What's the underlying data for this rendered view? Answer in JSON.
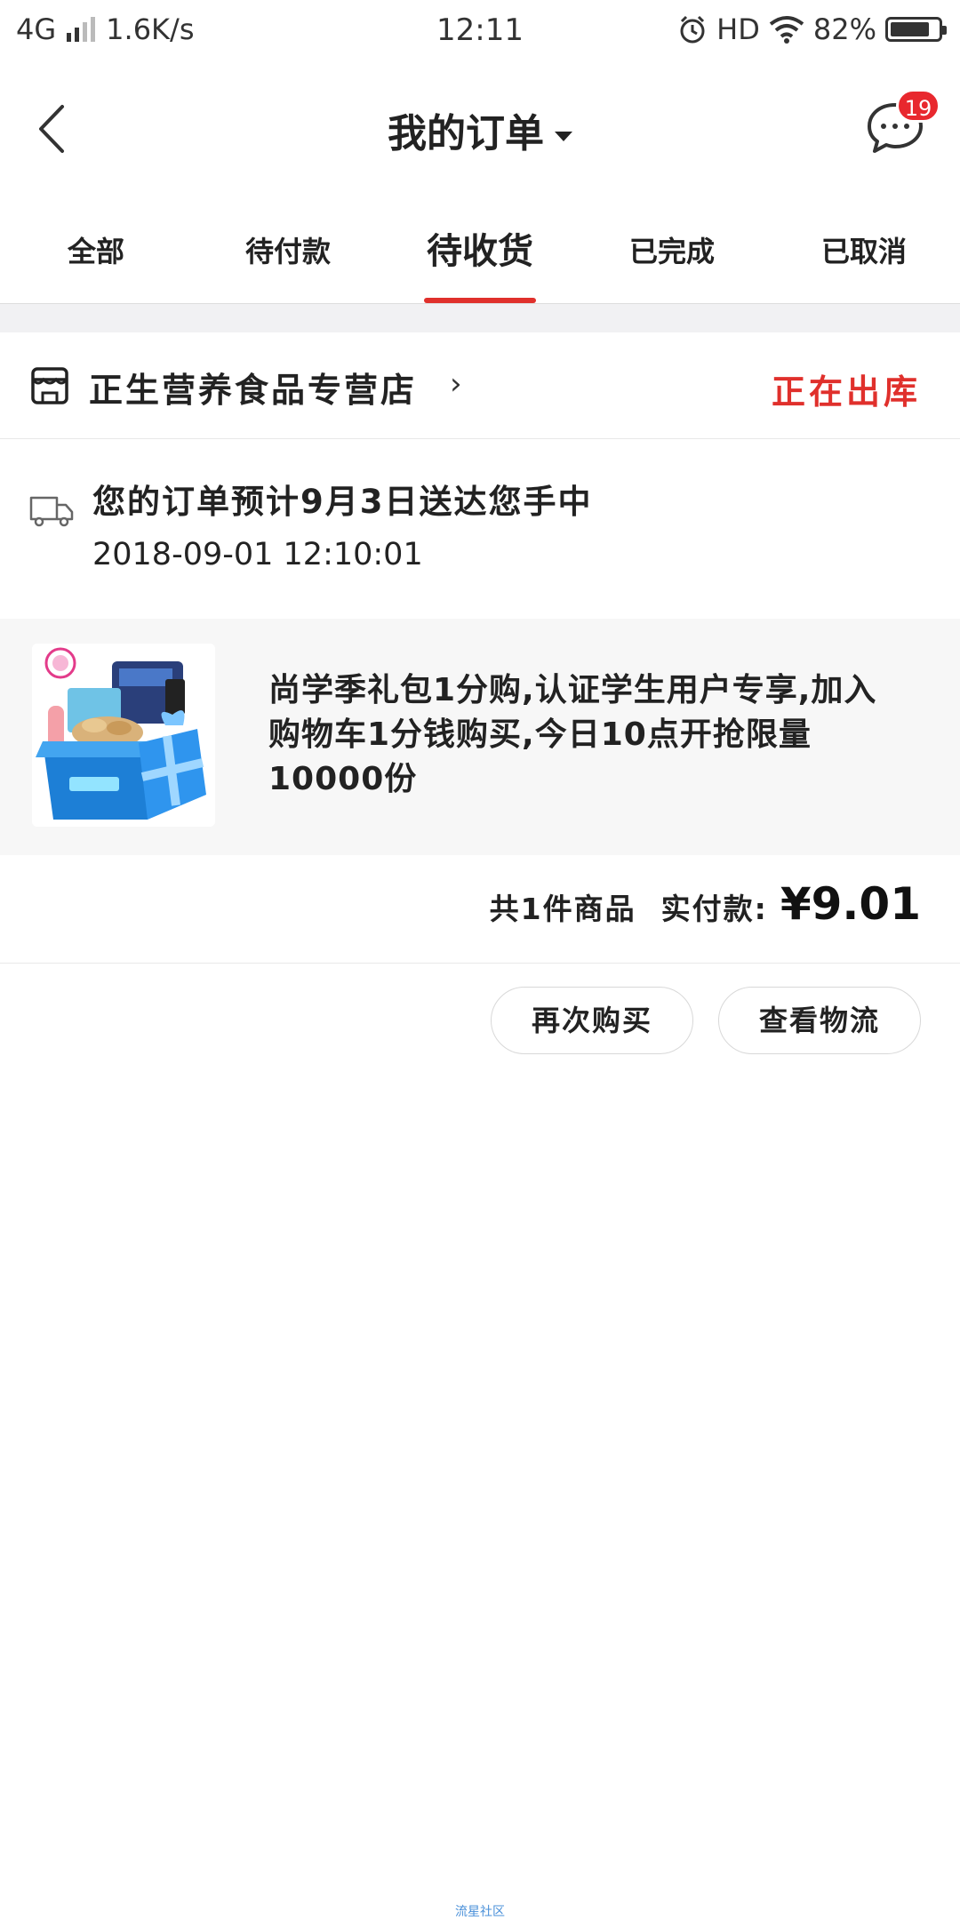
{
  "status_bar": {
    "network": "4G",
    "speed": "1.6K/s",
    "time": "12:11",
    "hd": "HD",
    "battery": "82%",
    "battery_level": 0.82
  },
  "header": {
    "title": "我的订单",
    "message_badge": "19"
  },
  "tabs": [
    {
      "label": "全部",
      "active": false
    },
    {
      "label": "待付款",
      "active": false
    },
    {
      "label": "待收货",
      "active": true
    },
    {
      "label": "已完成",
      "active": false
    },
    {
      "label": "已取消",
      "active": false
    }
  ],
  "order": {
    "store_name": "正生营养食品专营店",
    "store_arrow": "›",
    "status": "正在出库",
    "delivery_message": "您的订单预计9月3日送达您手中",
    "delivery_time": "2018-09-01 12:10:01",
    "product_title": "尚学季礼包1分购,认证学生用户专享,加入购物车1分钱购买,今日10点开抢限量10000份",
    "item_count": "共1件商品",
    "paid_label": "实付款:",
    "price": "¥9.01"
  },
  "actions": {
    "rebuy": "再次购买",
    "logistics": "查看物流"
  },
  "watermark": "流星社区",
  "colors": {
    "accent_red": "#e0302c",
    "badge_red": "#e8282e",
    "background_gray": "#f1f1f3"
  }
}
